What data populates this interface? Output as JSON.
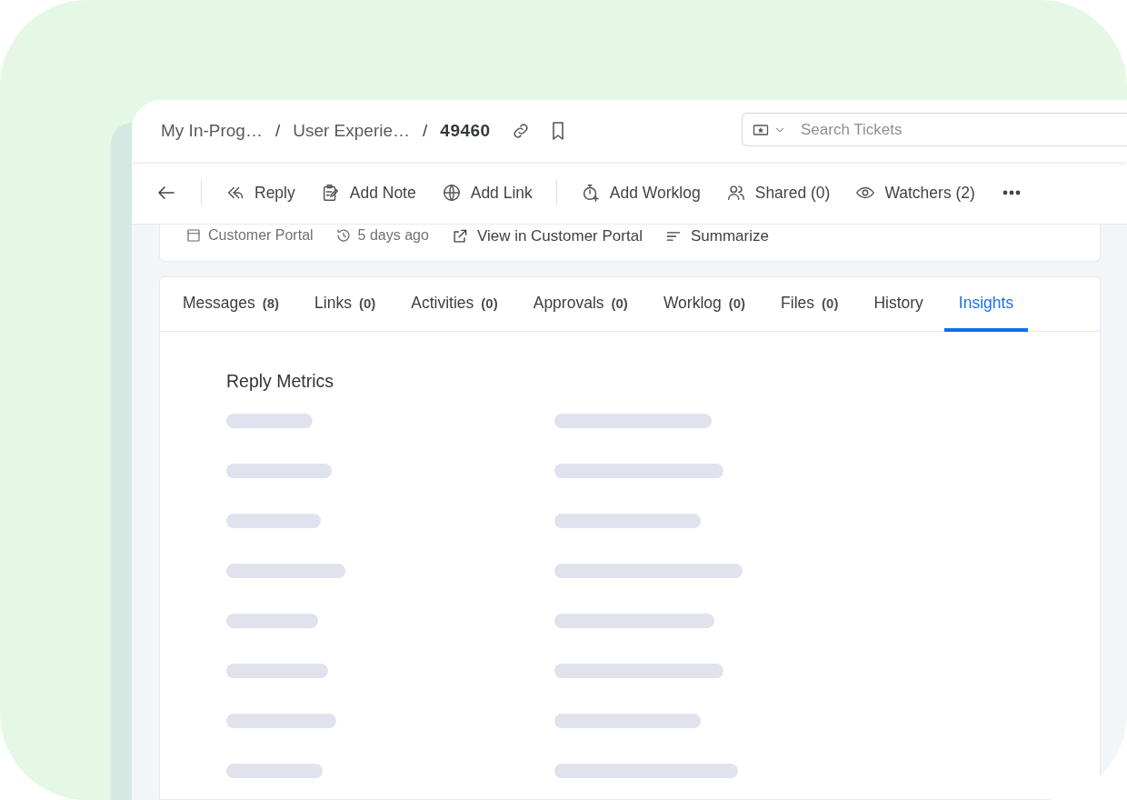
{
  "breadcrumbs": [
    {
      "label": "My In-Prog…",
      "current": false
    },
    {
      "label": "User Experie…",
      "current": false,
      "separator": "/"
    },
    {
      "label": "49460",
      "current": true,
      "separator": "/"
    }
  ],
  "search": {
    "placeholder": "Search Tickets"
  },
  "toolbar": [
    {
      "label": "Reply",
      "divider_before": true
    },
    {
      "label": "Add Note",
      "divider_before": false
    },
    {
      "label": "Add Link",
      "divider_before": false
    },
    {
      "label": "Add Worklog",
      "divider_before": true
    },
    {
      "label": "Shared (0)",
      "divider_before": false
    },
    {
      "label": "Watchers (2)",
      "divider_before": false
    }
  ],
  "meta": [
    {
      "kind": "info",
      "label": "Customer Portal"
    },
    {
      "kind": "info",
      "label": "5 days ago"
    },
    {
      "kind": "action",
      "label": "View in Customer Portal"
    },
    {
      "kind": "action",
      "label": "Summarize"
    }
  ],
  "tabs": [
    {
      "label": "Messages",
      "count": "(8)",
      "selected": false
    },
    {
      "label": "Links",
      "count": "(0)",
      "selected": false
    },
    {
      "label": "Activities",
      "count": "(0)",
      "selected": false
    },
    {
      "label": "Approvals",
      "count": "(0)",
      "selected": false
    },
    {
      "label": "Worklog",
      "count": "(0)",
      "selected": false
    },
    {
      "label": "Files",
      "count": "(0)",
      "selected": false
    },
    {
      "label": "History",
      "selected": false
    },
    {
      "label": "Insights",
      "selected": true
    }
  ],
  "reply_metrics": {
    "title": "Reply Metrics",
    "loading": true
  }
}
